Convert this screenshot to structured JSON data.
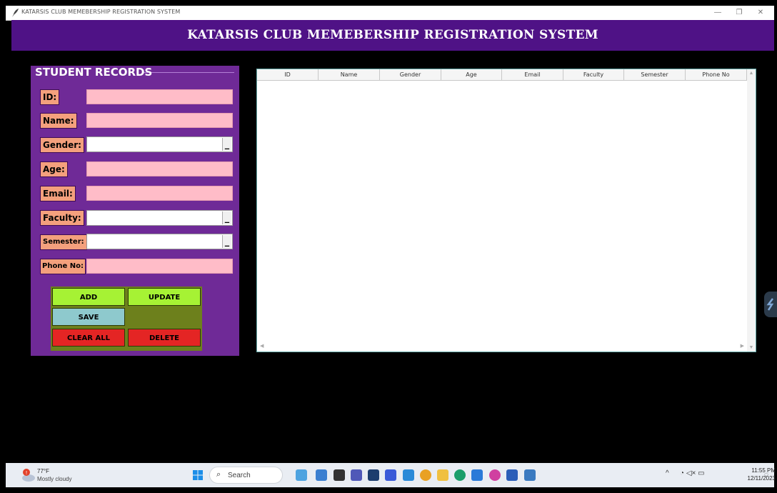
{
  "window": {
    "title": "KATARSIS CLUB MEMEBERSHIP REGISTRATION SYSTEM",
    "controls": {
      "minimize": "—",
      "restore": "❐",
      "close": "✕"
    }
  },
  "banner": {
    "text": "KATARSIS CLUB MEMEBERSHIP REGISTRATION SYSTEM"
  },
  "form": {
    "title": "STUDENT RECORDS",
    "fields": [
      {
        "label": "ID:",
        "type": "entry",
        "value": ""
      },
      {
        "label": "Name:",
        "type": "entry",
        "value": ""
      },
      {
        "label": "Gender:",
        "type": "combo",
        "value": ""
      },
      {
        "label": "Age:",
        "type": "entry",
        "value": ""
      },
      {
        "label": "Email:",
        "type": "entry",
        "value": ""
      },
      {
        "label": "Faculty:",
        "type": "combo",
        "value": ""
      },
      {
        "label": "Semester:",
        "type": "combo",
        "value": ""
      },
      {
        "label": "Phone No:",
        "type": "entry",
        "value": ""
      }
    ],
    "buttons": {
      "add": "ADD",
      "update": "UPDATE",
      "save": "SAVE",
      "clear_all": "CLEAR ALL",
      "delete": "DELETE"
    }
  },
  "table": {
    "columns": [
      "ID",
      "Name",
      "Gender",
      "Age",
      "Email",
      "Faculty",
      "Semester",
      "Phone No"
    ],
    "rows": []
  },
  "taskbar": {
    "weather": {
      "temp": "77°F",
      "desc": "Mostly cloudy"
    },
    "search_placeholder": "Search",
    "clock": {
      "time": "11:55 PM",
      "date": "12/11/2023"
    }
  },
  "colors": {
    "banner": "#4f1286",
    "panel": "#6f2a97",
    "label_bg": "#f4a07d",
    "entry_bg": "#ffbcc8",
    "button_area": "#6d801c",
    "btn_green": "#a6f234",
    "btn_teal": "#8ec9cd",
    "btn_red": "#e42524"
  }
}
